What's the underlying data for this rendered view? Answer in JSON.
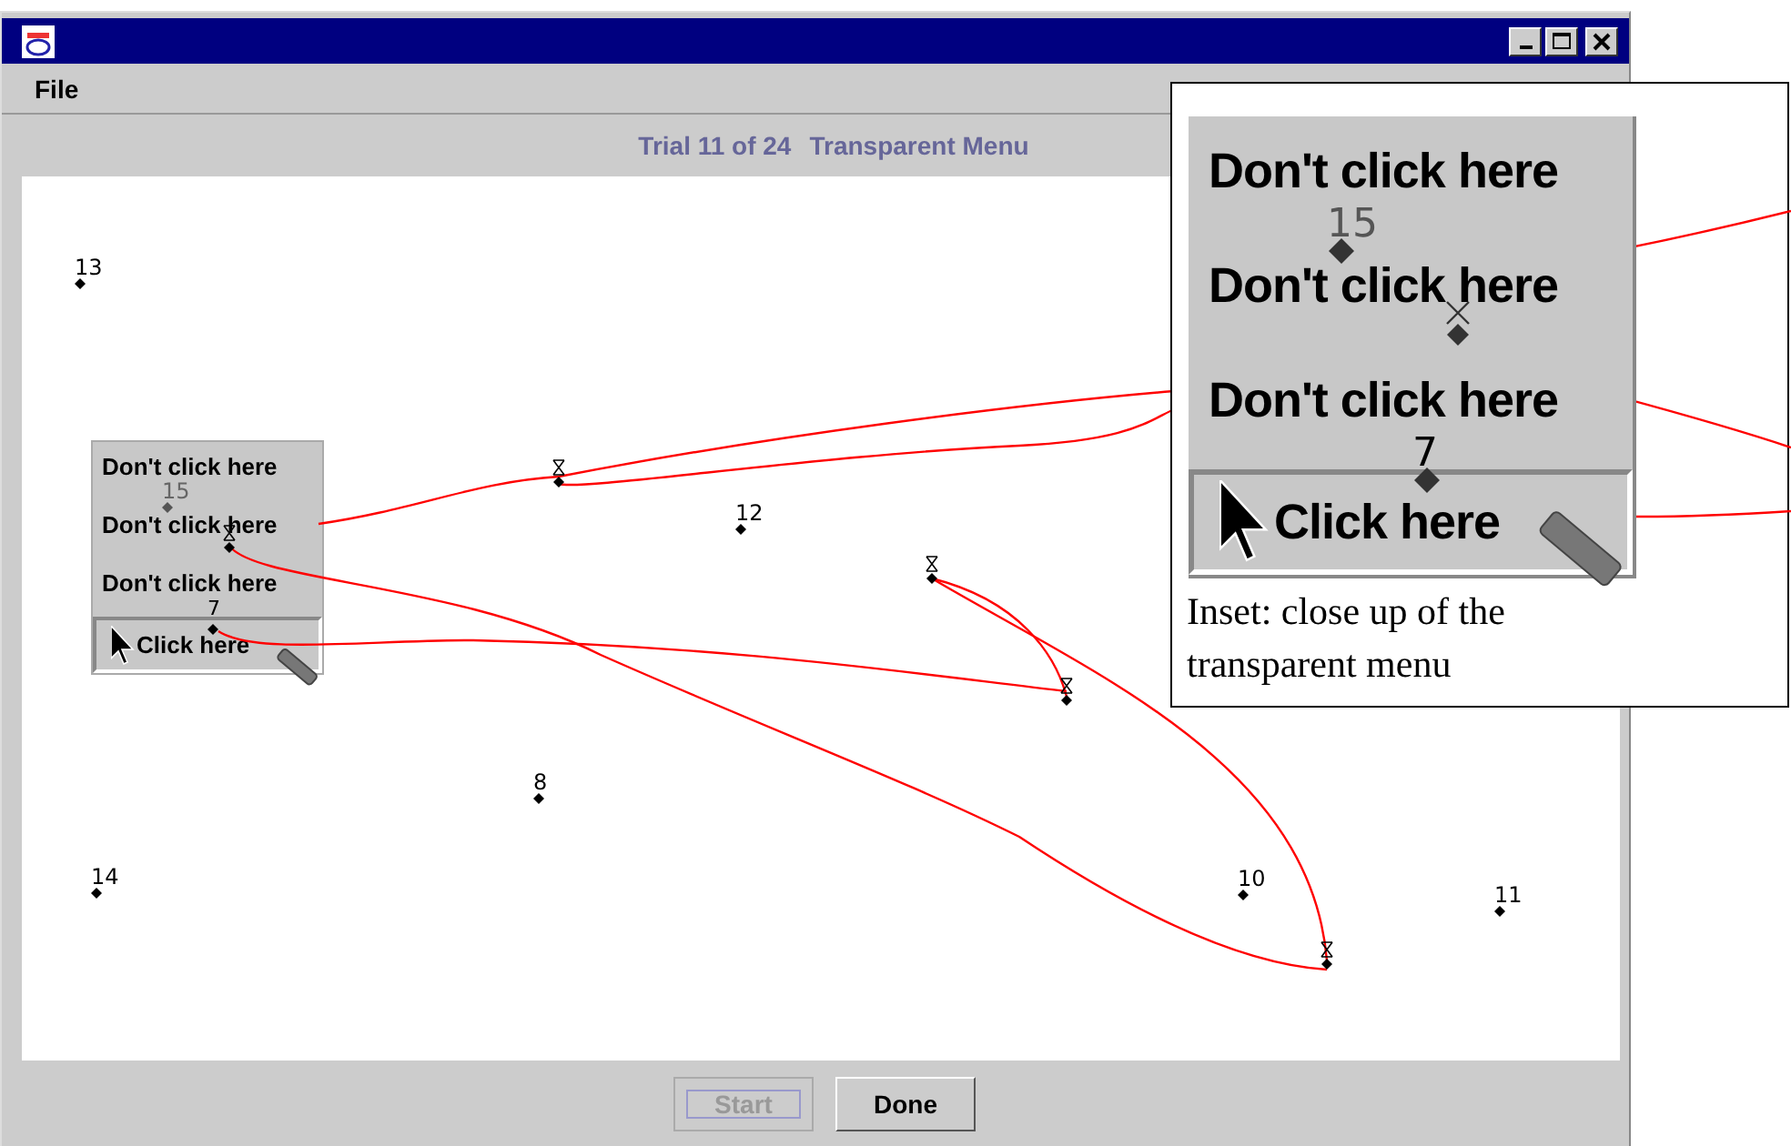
{
  "menubar": [
    {
      "label": "File"
    }
  ],
  "header": {
    "trial": "Trial 11 of 24",
    "condition": "Transparent Menu"
  },
  "targets": [
    {
      "label": "13"
    },
    {
      "label": "12"
    },
    {
      "label": "8"
    },
    {
      "label": "14"
    },
    {
      "label": "10"
    },
    {
      "label": "11"
    },
    {
      "label": "15"
    },
    {
      "label": "7"
    }
  ],
  "test_menu": {
    "items": [
      {
        "label": "Don't click here",
        "selected": false
      },
      {
        "label": "Don't click here",
        "selected": false
      },
      {
        "label": "Don't click here",
        "selected": false
      },
      {
        "label": "Click here",
        "selected": true
      }
    ]
  },
  "buttons": [
    {
      "label": "Start",
      "disabled": true
    },
    {
      "label": "Done",
      "disabled": false
    }
  ],
  "inset": {
    "items": [
      {
        "label": "Don't click here",
        "selected": false
      },
      {
        "label": "Don't click here",
        "selected": false
      },
      {
        "label": "Don't click here",
        "selected": false
      },
      {
        "label": "Click here",
        "selected": true
      }
    ],
    "targets": [
      {
        "label": "15"
      },
      {
        "label": "7"
      }
    ],
    "caption": "Inset: close up of the transparent menu"
  }
}
